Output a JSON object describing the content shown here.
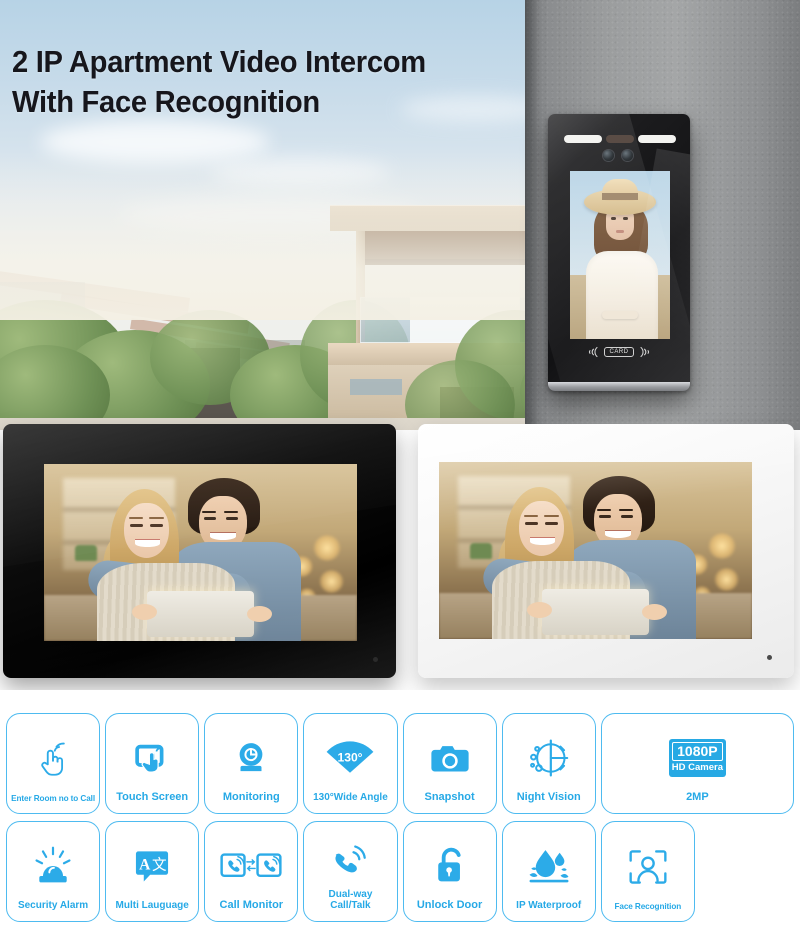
{
  "hero": {
    "title": "2 IP Apartment Video Intercom\nWith Face Recognition",
    "title_color": "#16161c"
  },
  "door_station": {
    "name": "face-recognition-door-station",
    "card_reader_label": "CARD",
    "screen_subject": "woman-in-straw-hat",
    "camera_count": 2,
    "ir_led_strips": 2
  },
  "monitors": [
    {
      "name": "indoor-monitor-black",
      "color": "#000000",
      "screen_subject": "couple-with-tablet"
    },
    {
      "name": "indoor-monitor-white",
      "color": "#ffffff",
      "screen_subject": "couple-with-tablet"
    }
  ],
  "features": {
    "accent_color": "#26a9e6",
    "border_color": "#4ebbf0",
    "items": [
      {
        "label": "Enter Room no to Call",
        "icon": "tap-hand-signal-icon",
        "size": "tiny"
      },
      {
        "label": "Touch Screen",
        "icon": "touch-screen-icon",
        "size": "normal"
      },
      {
        "label": "Monitoring",
        "icon": "dome-camera-icon",
        "size": "normal"
      },
      {
        "label": "130°Wide Angle",
        "icon": "wide-angle-icon",
        "size": "sm",
        "badge_text": "130°"
      },
      {
        "label": "Snapshot",
        "icon": "camera-icon",
        "size": "normal"
      },
      {
        "label": "Night Vision",
        "icon": "night-vision-icon",
        "size": "normal"
      },
      {
        "label": "2MP",
        "icon": "hd-1080p-badge-icon",
        "size": "normal",
        "badge_top": "1080P",
        "badge_bottom": "HD Camera"
      },
      {
        "label": "Security Alarm",
        "icon": "siren-alarm-icon",
        "size": "sm"
      },
      {
        "label": "Multi Lauguage",
        "icon": "translate-icon",
        "size": "sm",
        "badge_text": "A文"
      },
      {
        "label": "Call Monitor",
        "icon": "call-monitor-icon",
        "size": "normal"
      },
      {
        "label": "Dual-way\nCall/Talk",
        "icon": "handset-waves-icon",
        "size": "sm"
      },
      {
        "label": "Unlock Door",
        "icon": "unlock-padlock-icon",
        "size": "normal"
      },
      {
        "label": "IP Waterproof",
        "icon": "water-drop-splash-icon",
        "size": "sm"
      },
      {
        "label": "Face Recognition",
        "icon": "face-recognition-icon",
        "size": "tiny"
      }
    ]
  }
}
